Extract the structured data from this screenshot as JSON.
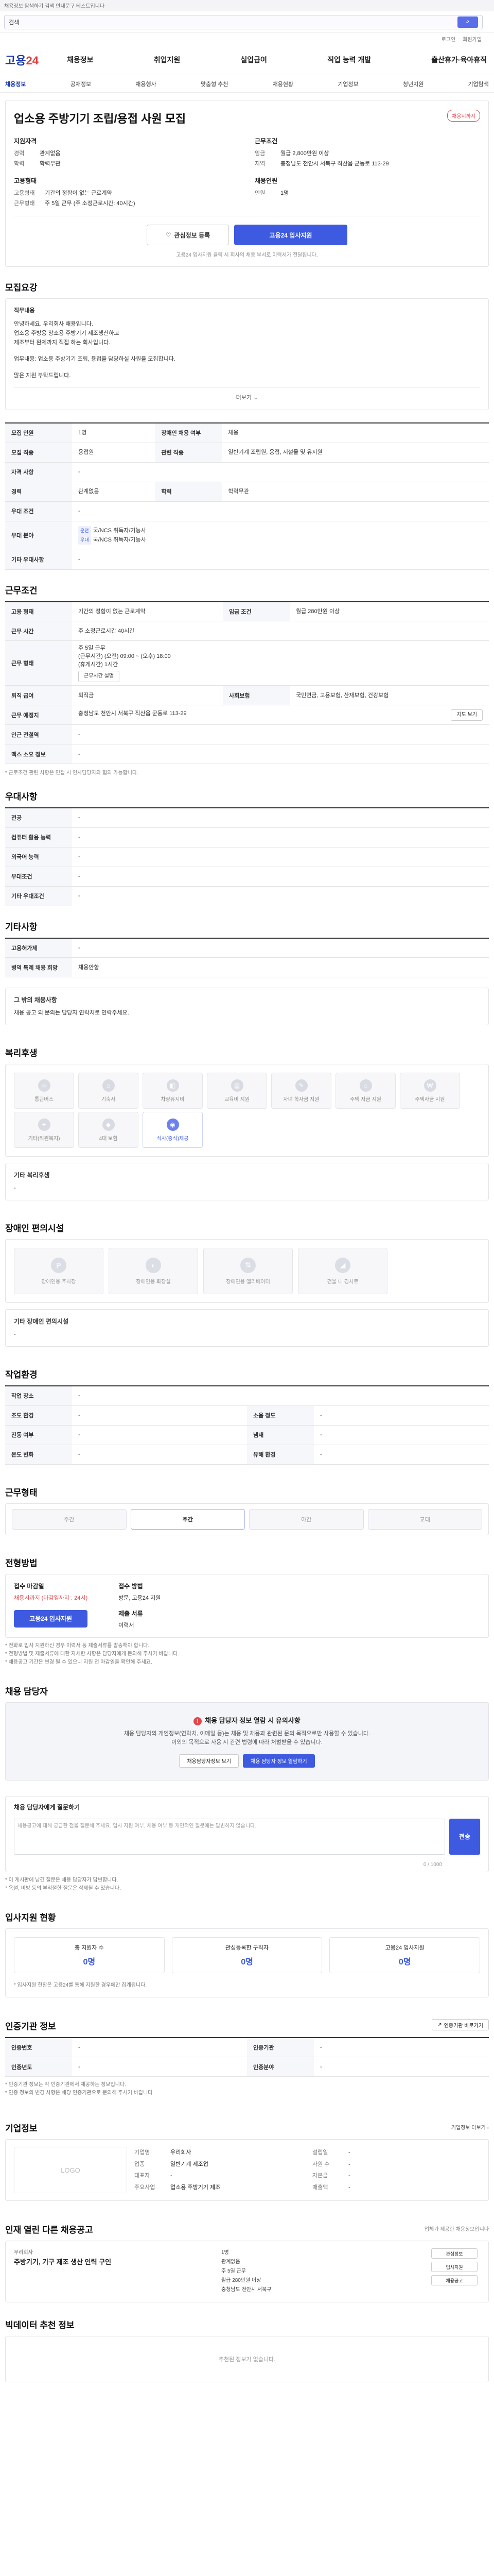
{
  "notice": "채용정보 탐색하기 검색 안내문구 테스트입니다",
  "search": {
    "value": "검색",
    "button_icon": "search-icon"
  },
  "topmeta": {
    "login": "로그인",
    "join": "회원가입"
  },
  "gnb": {
    "logo_main": "고용",
    "logo_accent": "24",
    "menu": [
      "채용정보",
      "취업지원",
      "실업급여",
      "직업 능력 개발",
      "출산휴가·육아휴직"
    ]
  },
  "lnb": [
    "채용정보",
    "공채정보",
    "채용행사",
    "맞춤형 추천",
    "채용현황",
    "기업정보",
    "청년지원",
    "기업탐색"
  ],
  "job": {
    "title": "업소용 주방기기 조립/용접 사원 모집",
    "deadline_badge": "채용시까지",
    "left_title": "지원자격",
    "left": [
      {
        "k": "경력",
        "v": "관계없음"
      },
      {
        "k": "학력",
        "v": "학력무관"
      }
    ],
    "right_title": "근무조건",
    "right": [
      {
        "k": "임금",
        "v": "월급 2,800만원 이상"
      },
      {
        "k": "지역",
        "v": "충청남도 천안시 서북구 직산읍 군동로 113-29"
      }
    ],
    "left2_title": "고용형태",
    "left2": [
      {
        "k": "고용형태",
        "v": "기간의 정함이 없는 근로계약"
      },
      {
        "k": "근무형태",
        "v": "주 5일 근무 (주 소정근로시간: 40시간)"
      }
    ],
    "right2_title": "채용인원",
    "right2": [
      {
        "k": "인원",
        "v": "1명"
      }
    ],
    "btn_interest": "관심정보 등록",
    "btn_apply": "고용24 입사지원",
    "apply_note": "고용24 입사지원 클릭 시 회사의 채용 부서로 이력서가 전달됩니다."
  },
  "detail": {
    "title": "모집요강",
    "heading": "직무내용",
    "body": [
      "안녕하세요. 우리회사 채용입니다.",
      "업소용 주방용 장소용 주방기기 제조생산하고",
      "제조부터 완제까지 직접 하는 회사입니다.",
      "",
      "업무내용: 업소용 주방기기 조립, 용접을 담당하실 사원을 모집합니다.",
      "",
      "많은 지원 부탁드립니다."
    ],
    "more": "더보기"
  },
  "recruit_table": [
    {
      "k": "모집 인원",
      "v": "1명",
      "k2": "장애인 채용 여부",
      "v2": "채용"
    },
    {
      "k": "모집 직종",
      "v": "용접원",
      "k2": "관련 직종",
      "v2": "일반기계 조립원, 용접, 시설물 및 유지원"
    },
    {
      "k": "자격 사항",
      "v": "-"
    },
    {
      "k": "경력",
      "v": "관계없음",
      "k2": "학력",
      "v2": "학력무관"
    },
    {
      "k": "우대 조건",
      "v": "-"
    },
    {
      "k": "우대 분야",
      "v": "국/NCS 취득자/기능사"
    },
    {
      "k": "기타 우대사항",
      "v": "-"
    }
  ],
  "recruit_tags": [
    "운전",
    "우대"
  ],
  "work": {
    "title": "근무조건",
    "rows": [
      {
        "k": "고용 형태",
        "v": "기간의 정함이 없는 근로계약",
        "k2": "임금 조건",
        "v2": "월급 280만원 이상"
      },
      {
        "k": "근무 시간",
        "v": "주 소정근로시간 40시간"
      },
      {
        "k": "근무 형태",
        "v": "주 5일 근무"
      },
      {
        "k": "퇴직 급여",
        "v": "퇴직금",
        "k2": "사회보험",
        "v2": "국민연금, 고용보험, 산재보험, 건강보험"
      },
      {
        "k": "근무 예정지",
        "v": "충청남도 천안시 서북구 직산읍 군동로 113-29"
      },
      {
        "k": "인근 전철역",
        "v": "-"
      },
      {
        "k": "맥스 소요 정보",
        "v": "-"
      }
    ],
    "work_time_detail": [
      "(근무시간) (오전) 09:00 ~ (오후) 18:00",
      "(휴게시간) 1시간"
    ],
    "work_time_link": "근무시간 설명",
    "map_button": "지도 보기",
    "note": "* 근로조건 관련 사항은 면접 시 인사담당자와 협의 가능합니다."
  },
  "etc_work": {
    "title": "우대사항",
    "rows": [
      {
        "k": "전공",
        "v": "-"
      },
      {
        "k": "컴퓨터 활용 능력",
        "v": "-"
      },
      {
        "k": "외국어 능력",
        "v": "-"
      },
      {
        "k": "우대조건",
        "v": "-"
      },
      {
        "k": "기타 우대조건",
        "v": "-"
      }
    ]
  },
  "etc": {
    "title": "기타사항",
    "rows": [
      {
        "k": "고용허가제",
        "v": "-"
      },
      {
        "k": "병역 특례 채용 희망",
        "v": "채용안함"
      }
    ],
    "extra_title": "그 밖의 채용사항",
    "extra_body": "채용 공고 외 문의는 담당자 연락처로 연락주세요."
  },
  "welfare": {
    "title": "복리후생",
    "items": [
      {
        "label": "통근버스",
        "on": false,
        "icon": "bus-icon"
      },
      {
        "label": "기숙사",
        "on": false,
        "icon": "house-icon"
      },
      {
        "label": "차량유지비",
        "on": false,
        "icon": "car-icon"
      },
      {
        "label": "교육비 지원",
        "on": false,
        "icon": "book-icon"
      },
      {
        "label": "자녀 학자금 지원",
        "on": false,
        "icon": "school-icon"
      },
      {
        "label": "주택 자금 지원",
        "on": false,
        "icon": "home-icon"
      },
      {
        "label": "주택자금 지원",
        "on": false,
        "icon": "money-icon"
      },
      {
        "label": "기타(직원복지)",
        "on": false,
        "icon": "gift-icon"
      },
      {
        "label": "4대 보험",
        "on": false,
        "icon": "shield-icon"
      },
      {
        "label": "식사(중식)제공",
        "on": true,
        "icon": "meal-icon"
      }
    ],
    "etc_title": "기타 복리후생",
    "etc_value": "-"
  },
  "disab": {
    "title": "장애인 편의시설",
    "items": [
      {
        "label": "장애인용 주차장",
        "icon": "parking-icon"
      },
      {
        "label": "장애인용 화장실",
        "icon": "toilet-icon"
      },
      {
        "label": "장애인용 엘리베이터",
        "icon": "elevator-icon"
      },
      {
        "label": "건물 내 경사로",
        "icon": "ramp-icon"
      }
    ],
    "etc_title": "기타 장애인 편의시설",
    "etc_value": "-"
  },
  "env": {
    "title": "작업환경",
    "rows": [
      {
        "k": "작업 장소",
        "v": "-",
        "k2": "",
        "v2": ""
      },
      {
        "k": "조도 환경",
        "v": "-",
        "k2": "소음 정도",
        "v2": "-"
      },
      {
        "k": "진동 여부",
        "v": "-",
        "k2": "냄새",
        "v2": "-"
      },
      {
        "k": "온도 변화",
        "v": "-",
        "k2": "유해 환경",
        "v2": "-"
      }
    ]
  },
  "shift": {
    "title": "근무형태",
    "items": [
      {
        "label": "주간",
        "on": false
      },
      {
        "label": "주간",
        "on": true
      },
      {
        "label": "야간",
        "on": false
      },
      {
        "label": "교대",
        "on": false
      }
    ]
  },
  "apply": {
    "title": "전형방법",
    "col1_h": "접수 마감일",
    "col1_v": "채용시까지 (마감일까지 : 24시)",
    "col2_h": "접수 방법",
    "col2_v": "방문, 고용24 지원",
    "col3_h": "제출 서류",
    "col3_v": "이력서",
    "apply_btn": "고용24 입사지원",
    "notes": [
      "* 전화로 입사 지원하신 경우 이력서 등 제출서류를 발송해야 합니다.",
      "* 전형방법 및 제출서류에 대한 자세한 사항은 담당자에게 문의해 주시기 바랍니다.",
      "* 채용공고 기간은 변경 될 수 있으니 지원 전 마감일을 확인해 주세요."
    ]
  },
  "contact": {
    "title": "채용 담당자",
    "warn": "채용 담당자 정보 열람 시 유의사항",
    "body1": "채용 담당자의 개인정보(연락처, 이메일 등)는 채용 및 채용과 관련된 문의 목적으로만 사용할 수 있습니다.",
    "body2": "이외의 목적으로 사용 시 관련 법령에 따라 처벌받을 수 있습니다.",
    "btn1": "채용담당자정보 보기",
    "btn2": "채용 담당자 정보 열람하기"
  },
  "qa": {
    "title": "채용 담당자에게 질문하기",
    "placeholder": "채용공고에 대해 궁금한 점을 질문해 주세요. 입사 지원 여부, 채용 여부 등 개인적인 질문에는 답변하지 않습니다.",
    "count": "0 / 1000",
    "send": "전송",
    "notes": [
      "* 이 게시판에 남긴 질문은 채용 담당자가 답변합니다.",
      "* 욕설, 비방 등의 부적절한 질문은 삭제될 수 있습니다."
    ]
  },
  "stats": {
    "title": "입사지원 현황",
    "items": [
      {
        "label": "총 지원자 수",
        "num": "0명"
      },
      {
        "label": "관심등록한 구직자",
        "num": "0명"
      },
      {
        "label": "고용24 입사지원",
        "num": "0명"
      }
    ],
    "note": "* 입사지원 현황은 고용24를 통해 지원한 경우에만 집계됩니다."
  },
  "cert": {
    "title": "인증기관 정보",
    "rows": [
      {
        "k": "인증번호",
        "v": "-",
        "k2": "인증기관",
        "v2": "-"
      },
      {
        "k": "인증년도",
        "v": "-",
        "k2": "인증분야",
        "v2": "-"
      }
    ],
    "btn": "인증기관 바로가기",
    "notes": [
      "* 인증기관 정보는 각 인증기관에서 제공하는 정보입니다.",
      "* 인증 정보의 변경 사항은 해당 인증기관으로 문의해 주시기 바랍니다."
    ]
  },
  "org": {
    "title": "기업정보",
    "more": "기업정보 더보기",
    "logo": "LOGO",
    "rows": [
      {
        "k": "기업명",
        "v": "우리회사"
      },
      {
        "k": "설립일",
        "v": "-"
      },
      {
        "k": "업종",
        "v": "일반기계 제조업"
      },
      {
        "k": "사원 수",
        "v": "-"
      },
      {
        "k": "대표자",
        "v": "-"
      },
      {
        "k": "자본금",
        "v": "-"
      },
      {
        "k": "주요사업",
        "v": "업소용 주방기기 제조"
      },
      {
        "k": "매출액",
        "v": "-"
      }
    ]
  },
  "similar": {
    "title": "인재 열린 다른 채용공고",
    "right_note": "업체가 제공한 채용정보입니다",
    "company": "우리회사",
    "job_title": "주방기기, 기구 제조 생산 인력 구인",
    "meta": [
      "1명",
      "관계없음",
      "주 5일 근무",
      "월급 280만원 이상",
      "충청남도 천안시 서북구"
    ],
    "btns": [
      "관심정보",
      "입사지원",
      "채용공고"
    ]
  },
  "recommend": {
    "title": "빅데이터 추천 정보",
    "empty": "추천된 정보가 없습니다."
  }
}
